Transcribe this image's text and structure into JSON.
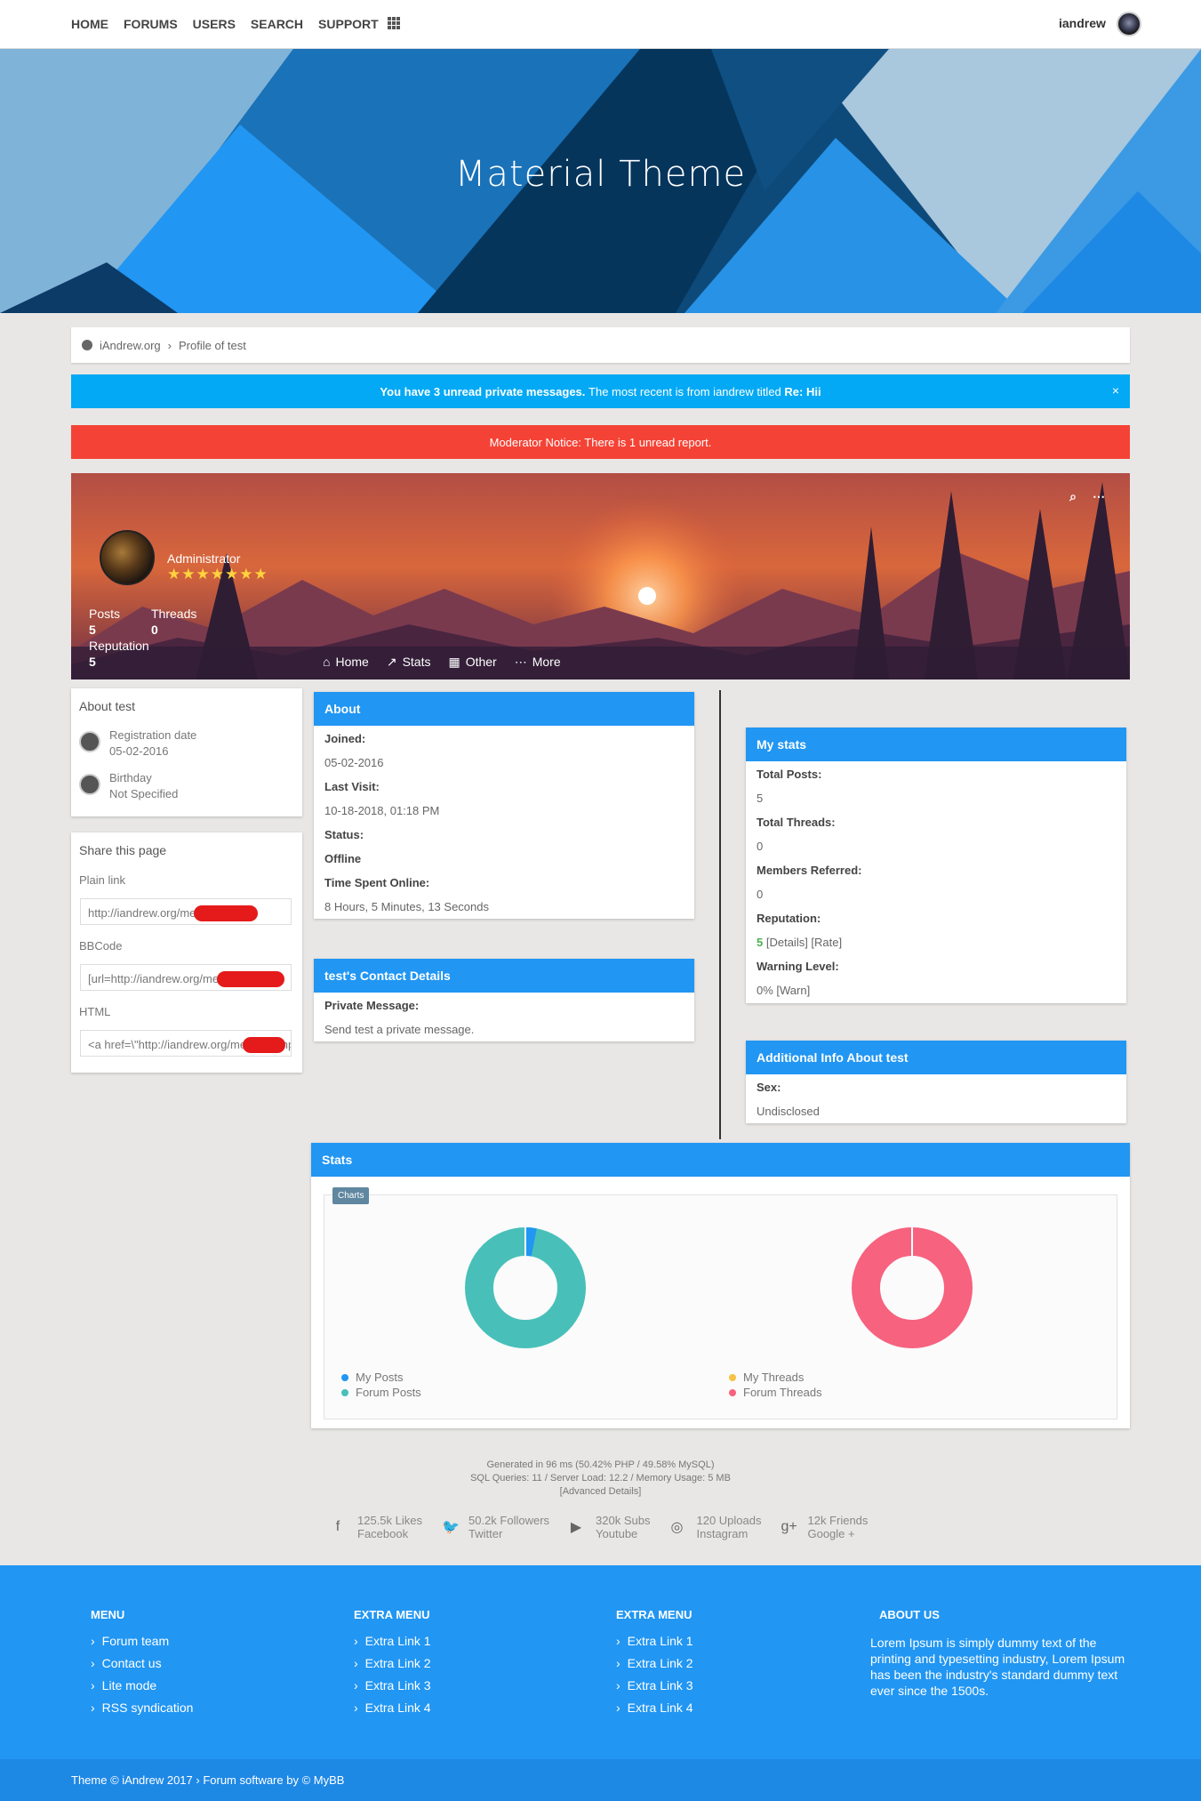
{
  "nav": {
    "links": [
      "HOME",
      "FORUMS",
      "USERS",
      "SEARCH",
      "SUPPORT"
    ],
    "username": "iandrew"
  },
  "hero": {
    "title": "Material Theme"
  },
  "breadcrumb": {
    "home": "iAndrew.org",
    "current": "Profile of test"
  },
  "pm_alert": {
    "bold": "You have 3 unread private messages.",
    "text": "The most recent is from iandrew titled",
    "subject": "Re: Hii",
    "close": "×"
  },
  "mod_notice": {
    "text": "Moderator Notice: There is 1 unread report."
  },
  "profile_banner": {
    "group": "Administrator",
    "stars": "★★★★★★★",
    "posts_label": "Posts",
    "posts_value": "5",
    "threads_label": "Threads",
    "threads_value": "0",
    "rep_label": "Reputation",
    "rep_value": "5",
    "tabs": [
      {
        "icon": "home-icon",
        "label": "Home"
      },
      {
        "icon": "stats-icon",
        "label": "Stats"
      },
      {
        "icon": "grid-icon",
        "label": "Other"
      },
      {
        "icon": "dots-icon",
        "label": "More"
      }
    ]
  },
  "about_side": {
    "title": "About test",
    "reg_label": "Registration date",
    "reg_value": "05-02-2016",
    "bday_label": "Birthday",
    "bday_value": "Not Specified"
  },
  "share": {
    "title": "Share this page",
    "plain_label": "Plain link",
    "plain_value": "http://iandrew.org/member.php",
    "bb_label": "BBCode",
    "bb_value": "[url=http://iandrew.org/member.php",
    "html_label": "HTML",
    "html_value": "<a href=\\\"http://iandrew.org/member.php"
  },
  "about": {
    "title": "About",
    "joined_label": "Joined:",
    "joined": "05-02-2016",
    "last_label": "Last Visit:",
    "last": "10-18-2018, 01:18 PM",
    "status_label": "Status:",
    "status": "Offline",
    "online_label": "Time Spent Online:",
    "online": "8 Hours, 5 Minutes, 13 Seconds"
  },
  "contact": {
    "title": "test's Contact Details",
    "pm_label": "Private Message:",
    "pm_value": "Send test a private message."
  },
  "mystats": {
    "title": "My stats",
    "posts_label": "Total Posts:",
    "posts": "5",
    "threads_label": "Total Threads:",
    "threads": "0",
    "ref_label": "Members Referred:",
    "ref": "0",
    "rep_label": "Reputation:",
    "rep": "5",
    "rep_links": "[Details] [Rate]",
    "warn_label": "Warning Level:",
    "warn": "0% [Warn]"
  },
  "additional": {
    "title": "Additional Info About test",
    "sex_label": "Sex:",
    "sex": "Undisclosed"
  },
  "stats": {
    "title": "Stats",
    "tag": "Charts",
    "legend1": [
      "My Posts",
      "Forum Posts"
    ],
    "legend2": [
      "My Threads",
      "Forum Threads"
    ],
    "colors": {
      "my_posts": "#2196f3",
      "forum_posts": "#48c0b9",
      "my_threads": "#f5c243",
      "forum_threads": "#f7627f"
    },
    "posts_share": 0.03,
    "threads_share": 0.0
  },
  "generated": {
    "line1": "Generated in 96 ms (50.42% PHP / 49.58% MySQL)",
    "line2": "SQL Queries: 11 / Server Load: 12.2 / Memory Usage: 5 MB",
    "line3": "[Advanced Details]"
  },
  "social": [
    {
      "icon": "facebook-icon",
      "glyph": "f",
      "count": "125.5k Likes",
      "name": "Facebook"
    },
    {
      "icon": "twitter-icon",
      "glyph": "🐦",
      "count": "50.2k Followers",
      "name": "Twitter"
    },
    {
      "icon": "youtube-icon",
      "glyph": "▶",
      "count": "320k Subs",
      "name": "Youtube"
    },
    {
      "icon": "instagram-icon",
      "glyph": "◎",
      "count": "120 Uploads",
      "name": "Instagram"
    },
    {
      "icon": "googleplus-icon",
      "glyph": "g+",
      "count": "12k Friends",
      "name": "Google +"
    }
  ],
  "footer": {
    "cols": [
      {
        "title": "MENU",
        "items": [
          "Forum team",
          "Contact us",
          "Lite mode",
          "RSS syndication"
        ]
      },
      {
        "title": "EXTRA MENU",
        "items": [
          "Extra Link 1",
          "Extra Link 2",
          "Extra Link 3",
          "Extra Link 4"
        ]
      },
      {
        "title": "EXTRA MENU",
        "items": [
          "Extra Link 1",
          "Extra Link 2",
          "Extra Link 3",
          "Extra Link 4"
        ]
      }
    ],
    "about_title": "ABOUT US",
    "about_text": "Lorem Ipsum is simply dummy text of the printing and typesetting industry, Lorem Ipsum has been the industry's standard dummy text ever since the 1500s.",
    "copyright": "Theme © iAndrew 2017 › Forum software by © MyBB"
  }
}
